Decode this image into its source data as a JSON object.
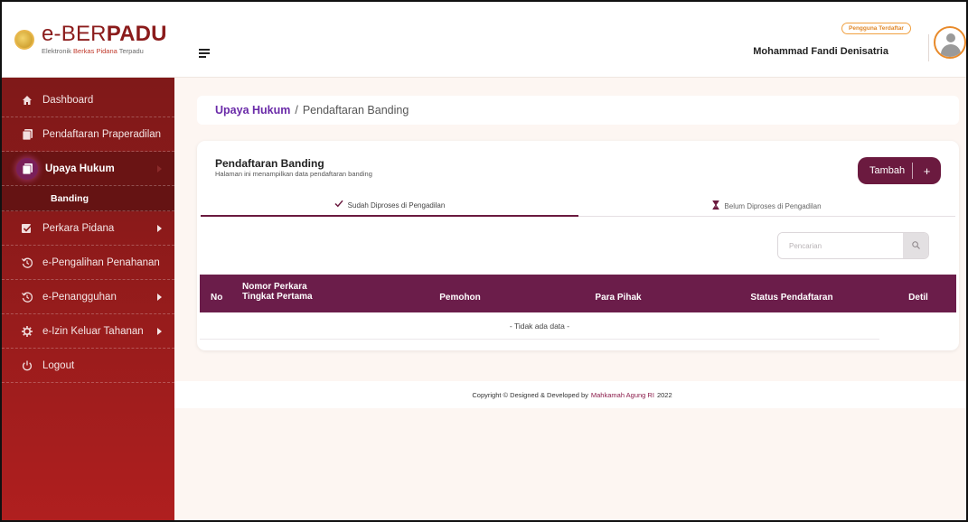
{
  "brand": {
    "title_prefix": "e-BER",
    "title_bold": "PADU",
    "subtitle_part1": "Elektronik ",
    "subtitle_red": "Berkas Pidana",
    "subtitle_part2": " Terpadu"
  },
  "sidebar": {
    "items": [
      {
        "label": "Dashboard",
        "icon": "home-icon"
      },
      {
        "label": "Pendaftaran Praperadilan",
        "icon": "document-icon"
      },
      {
        "label": "Upaya Hukum",
        "icon": "document-icon",
        "active": true
      },
      {
        "label": "Banding",
        "sub": true
      },
      {
        "label": "Perkara Pidana",
        "icon": "check-box-icon",
        "has_caret": true
      },
      {
        "label": "e-Pengalihan Penahanan",
        "icon": "history-icon"
      },
      {
        "label": "e-Penangguhan",
        "icon": "history-icon",
        "has_caret": true
      },
      {
        "label": "e-Izin Keluar Tahanan",
        "icon": "gear-icon",
        "has_caret": true
      },
      {
        "label": "Logout",
        "icon": "power-icon"
      }
    ]
  },
  "header": {
    "badge": "Pengguna Terdaftar",
    "username": "Mohammad Fandi Denisatria"
  },
  "breadcrumb": {
    "parent": "Upaya Hukum",
    "separator": "/",
    "current": "Pendaftaran Banding"
  },
  "card": {
    "title": "Pendaftaran Banding",
    "subtitle": "Halaman ini menampilkan data pendaftaran banding",
    "add_label": "Tambah",
    "add_plus": "+"
  },
  "tabs": [
    {
      "label": "Sudah Diproses di Pengadilan",
      "icon": "check-icon",
      "active": true
    },
    {
      "label": "Belum Diproses di Pengadilan",
      "icon": "hourglass-icon",
      "active": false
    }
  ],
  "search": {
    "placeholder": "Pencarian",
    "value": ""
  },
  "table": {
    "columns": {
      "no": "No",
      "nomor_line1": "Nomor Perkara",
      "nomor_line2": "Tingkat Pertama",
      "pemohon": "Pemohon",
      "para_pihak": "Para Pihak",
      "status": "Status Pendaftaran",
      "detil": "Detil"
    },
    "empty_message": "- Tidak ada data -"
  },
  "footer": {
    "prefix": "Copyright © Designed & Developed by",
    "org": "Mahkamah Agung RI",
    "year": "2022"
  },
  "colors": {
    "sidebar_top": "#7a1818",
    "sidebar_bottom": "#b01f1f",
    "primary": "#6b1a3f",
    "link": "#6a2aa8",
    "badge": "#e0882a"
  }
}
